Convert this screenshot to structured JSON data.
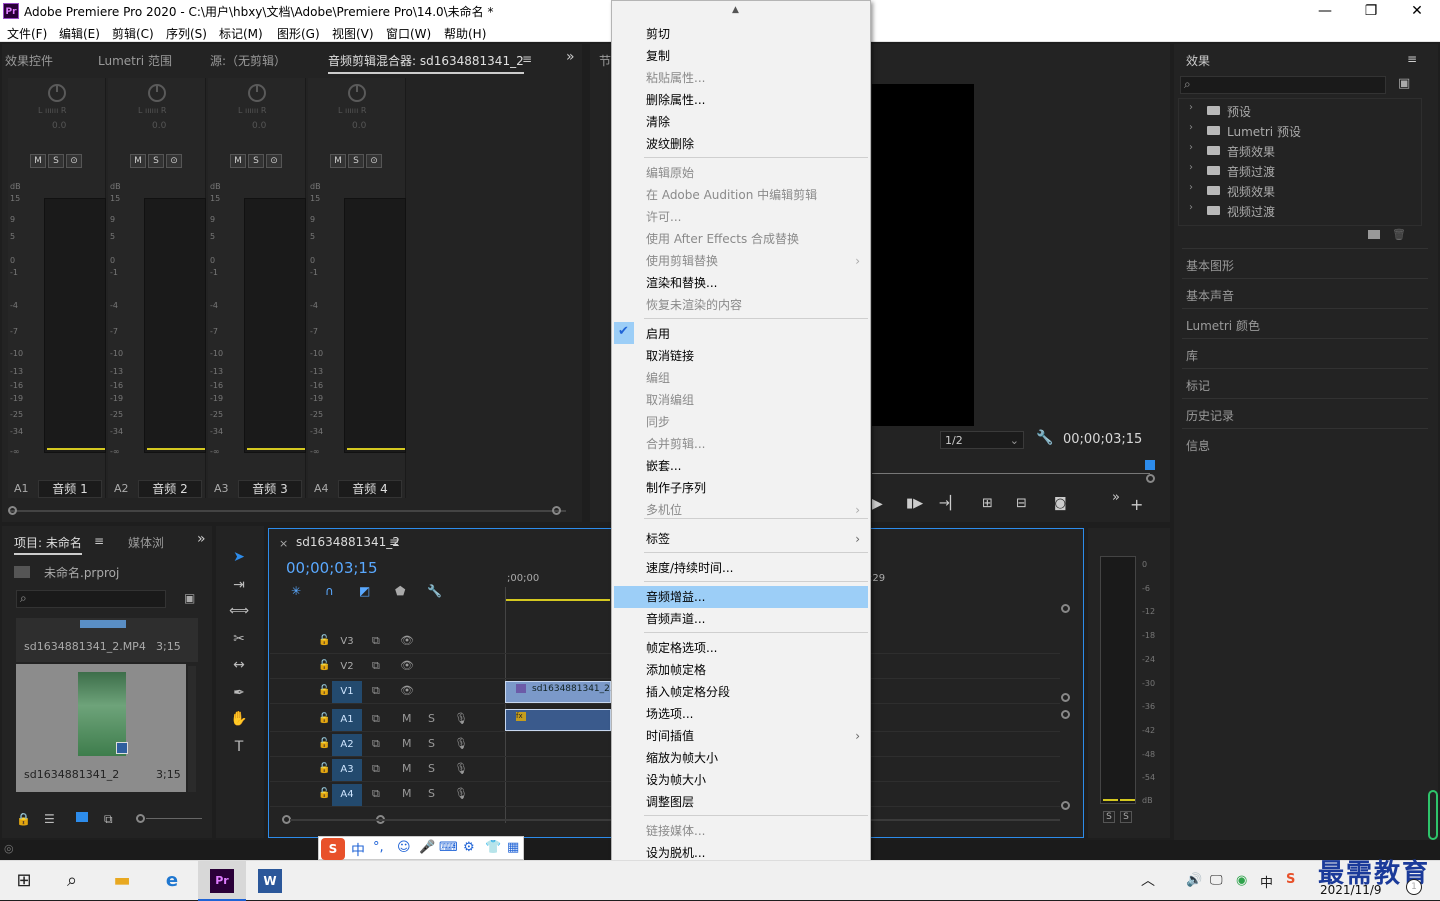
{
  "window": {
    "title": "Adobe Premiere Pro 2020 - C:\\用户\\hbxy\\文档\\Adobe\\Premiere Pro\\14.0\\未命名 *",
    "app_icon": "Pr",
    "controls": {
      "minimize": "—",
      "maximize": "❐",
      "close": "✕"
    }
  },
  "menubar": [
    "文件(F)",
    "编辑(E)",
    "剪辑(C)",
    "序列(S)",
    "标记(M)",
    "图形(G)",
    "视图(V)",
    "窗口(W)",
    "帮助(H)"
  ],
  "top_left_panel": {
    "tabs": [
      "效果控件",
      "Lumetri 范围",
      "源:（无剪辑）",
      "音频剪辑混合器: sd1634881341_2"
    ],
    "active_tab": 3,
    "menu_icon": "≡",
    "overflow_icon": "»",
    "channels": [
      {
        "id": "A1",
        "name": "音频 1",
        "value": "0.0"
      },
      {
        "id": "A2",
        "name": "音频 2",
        "value": "0.0"
      },
      {
        "id": "A3",
        "name": "音频 3",
        "value": "0.0"
      },
      {
        "id": "A4",
        "name": "音频 4",
        "value": "0.0"
      }
    ],
    "ms_labels": [
      "M",
      "S",
      "⊙"
    ],
    "lr_label": "L ıııııı R",
    "db_label": "dB",
    "db_scale": [
      "15",
      "9",
      "5",
      "0",
      "-1",
      "-4",
      "-7",
      "-10",
      "-13",
      "-16",
      "-19",
      "-25",
      "-34",
      "-∞"
    ]
  },
  "program_monitor": {
    "tab_fragment": "节",
    "zoom": "1/2",
    "timecode": "00;00;03;15"
  },
  "effects_panel": {
    "title": "效果",
    "menu_icon": "≡",
    "search_icon": "⌕",
    "items": [
      "预设",
      "Lumetri 预设",
      "音频效果",
      "音频过渡",
      "视频效果",
      "视频过渡"
    ],
    "collapsed_panels": [
      "基本图形",
      "基本声音",
      "Lumetri 颜色",
      "库",
      "标记",
      "历史记录",
      "信息"
    ]
  },
  "project_panel": {
    "tabs": [
      "项目: 未命名",
      "媒体浏"
    ],
    "project_file": "未命名.prproj",
    "items": [
      {
        "name": "sd1634881341_2.MP4",
        "duration": "3;15"
      },
      {
        "name": "sd1634881341_2",
        "duration": "3;15"
      }
    ]
  },
  "timeline": {
    "sequence_tab": "sd1634881341_2",
    "timecode": "00;00;03;15",
    "ruler_start": ";00;00",
    "ruler_end": ";29",
    "video_tracks": [
      "V3",
      "V2",
      "V1"
    ],
    "audio_tracks": [
      "A1",
      "A2",
      "A3",
      "A4"
    ],
    "clip_label": "sd1634881341_2.M",
    "fx_label": "fx"
  },
  "audio_meter": {
    "scale": [
      "0",
      "-6",
      "-12",
      "-18",
      "-24",
      "-30",
      "-36",
      "-42",
      "-48",
      "-54",
      "dB"
    ],
    "buttons": [
      "S",
      "S"
    ]
  },
  "context_menu": {
    "items": [
      {
        "label": "剪切",
        "enabled": true
      },
      {
        "label": "复制",
        "enabled": true
      },
      {
        "label": "粘贴属性...",
        "enabled": false
      },
      {
        "label": "删除属性...",
        "enabled": true
      },
      {
        "label": "清除",
        "enabled": true
      },
      {
        "label": "波纹删除",
        "enabled": true
      },
      {
        "label": "编辑原始",
        "enabled": false
      },
      {
        "label": "在 Adobe Audition 中编辑剪辑",
        "enabled": false
      },
      {
        "label": "许可...",
        "enabled": false
      },
      {
        "label": "使用 After Effects 合成替换",
        "enabled": false
      },
      {
        "label": "使用剪辑替换",
        "enabled": false
      },
      {
        "label": "渲染和替换...",
        "enabled": true
      },
      {
        "label": "恢复未渲染的内容",
        "enabled": false
      },
      {
        "label": "启用",
        "enabled": true
      },
      {
        "label": "取消链接",
        "enabled": true
      },
      {
        "label": "编组",
        "enabled": false
      },
      {
        "label": "取消编组",
        "enabled": false
      },
      {
        "label": "同步",
        "enabled": false
      },
      {
        "label": "合并剪辑...",
        "enabled": false
      },
      {
        "label": "嵌套...",
        "enabled": true
      },
      {
        "label": "制作子序列",
        "enabled": true
      },
      {
        "label": "多机位",
        "enabled": false
      },
      {
        "label": "标签",
        "enabled": true
      },
      {
        "label": "速度/持续时间...",
        "enabled": true
      },
      {
        "label": "音频增益...",
        "enabled": true
      },
      {
        "label": "音频声道...",
        "enabled": true
      },
      {
        "label": "帧定格选项...",
        "enabled": true
      },
      {
        "label": "添加帧定格",
        "enabled": true
      },
      {
        "label": "插入帧定格分段",
        "enabled": true
      },
      {
        "label": "场选项...",
        "enabled": true
      },
      {
        "label": "时间插值",
        "enabled": true
      },
      {
        "label": "缩放为帧大小",
        "enabled": true
      },
      {
        "label": "设为帧大小",
        "enabled": true
      },
      {
        "label": "调整图层",
        "enabled": true
      },
      {
        "label": "链接媒体...",
        "enabled": false
      },
      {
        "label": "设为脱机...",
        "enabled": true
      }
    ],
    "highlighted": "音频增益...",
    "checked": "启用",
    "scroll_up": "▲",
    "scroll_down": "▼"
  },
  "ime_toolbar": {
    "logo": "S",
    "mode": "中"
  },
  "taskbar": {
    "date": "2021/11/9",
    "tray_lang": "中",
    "watermark": "最需教育"
  }
}
